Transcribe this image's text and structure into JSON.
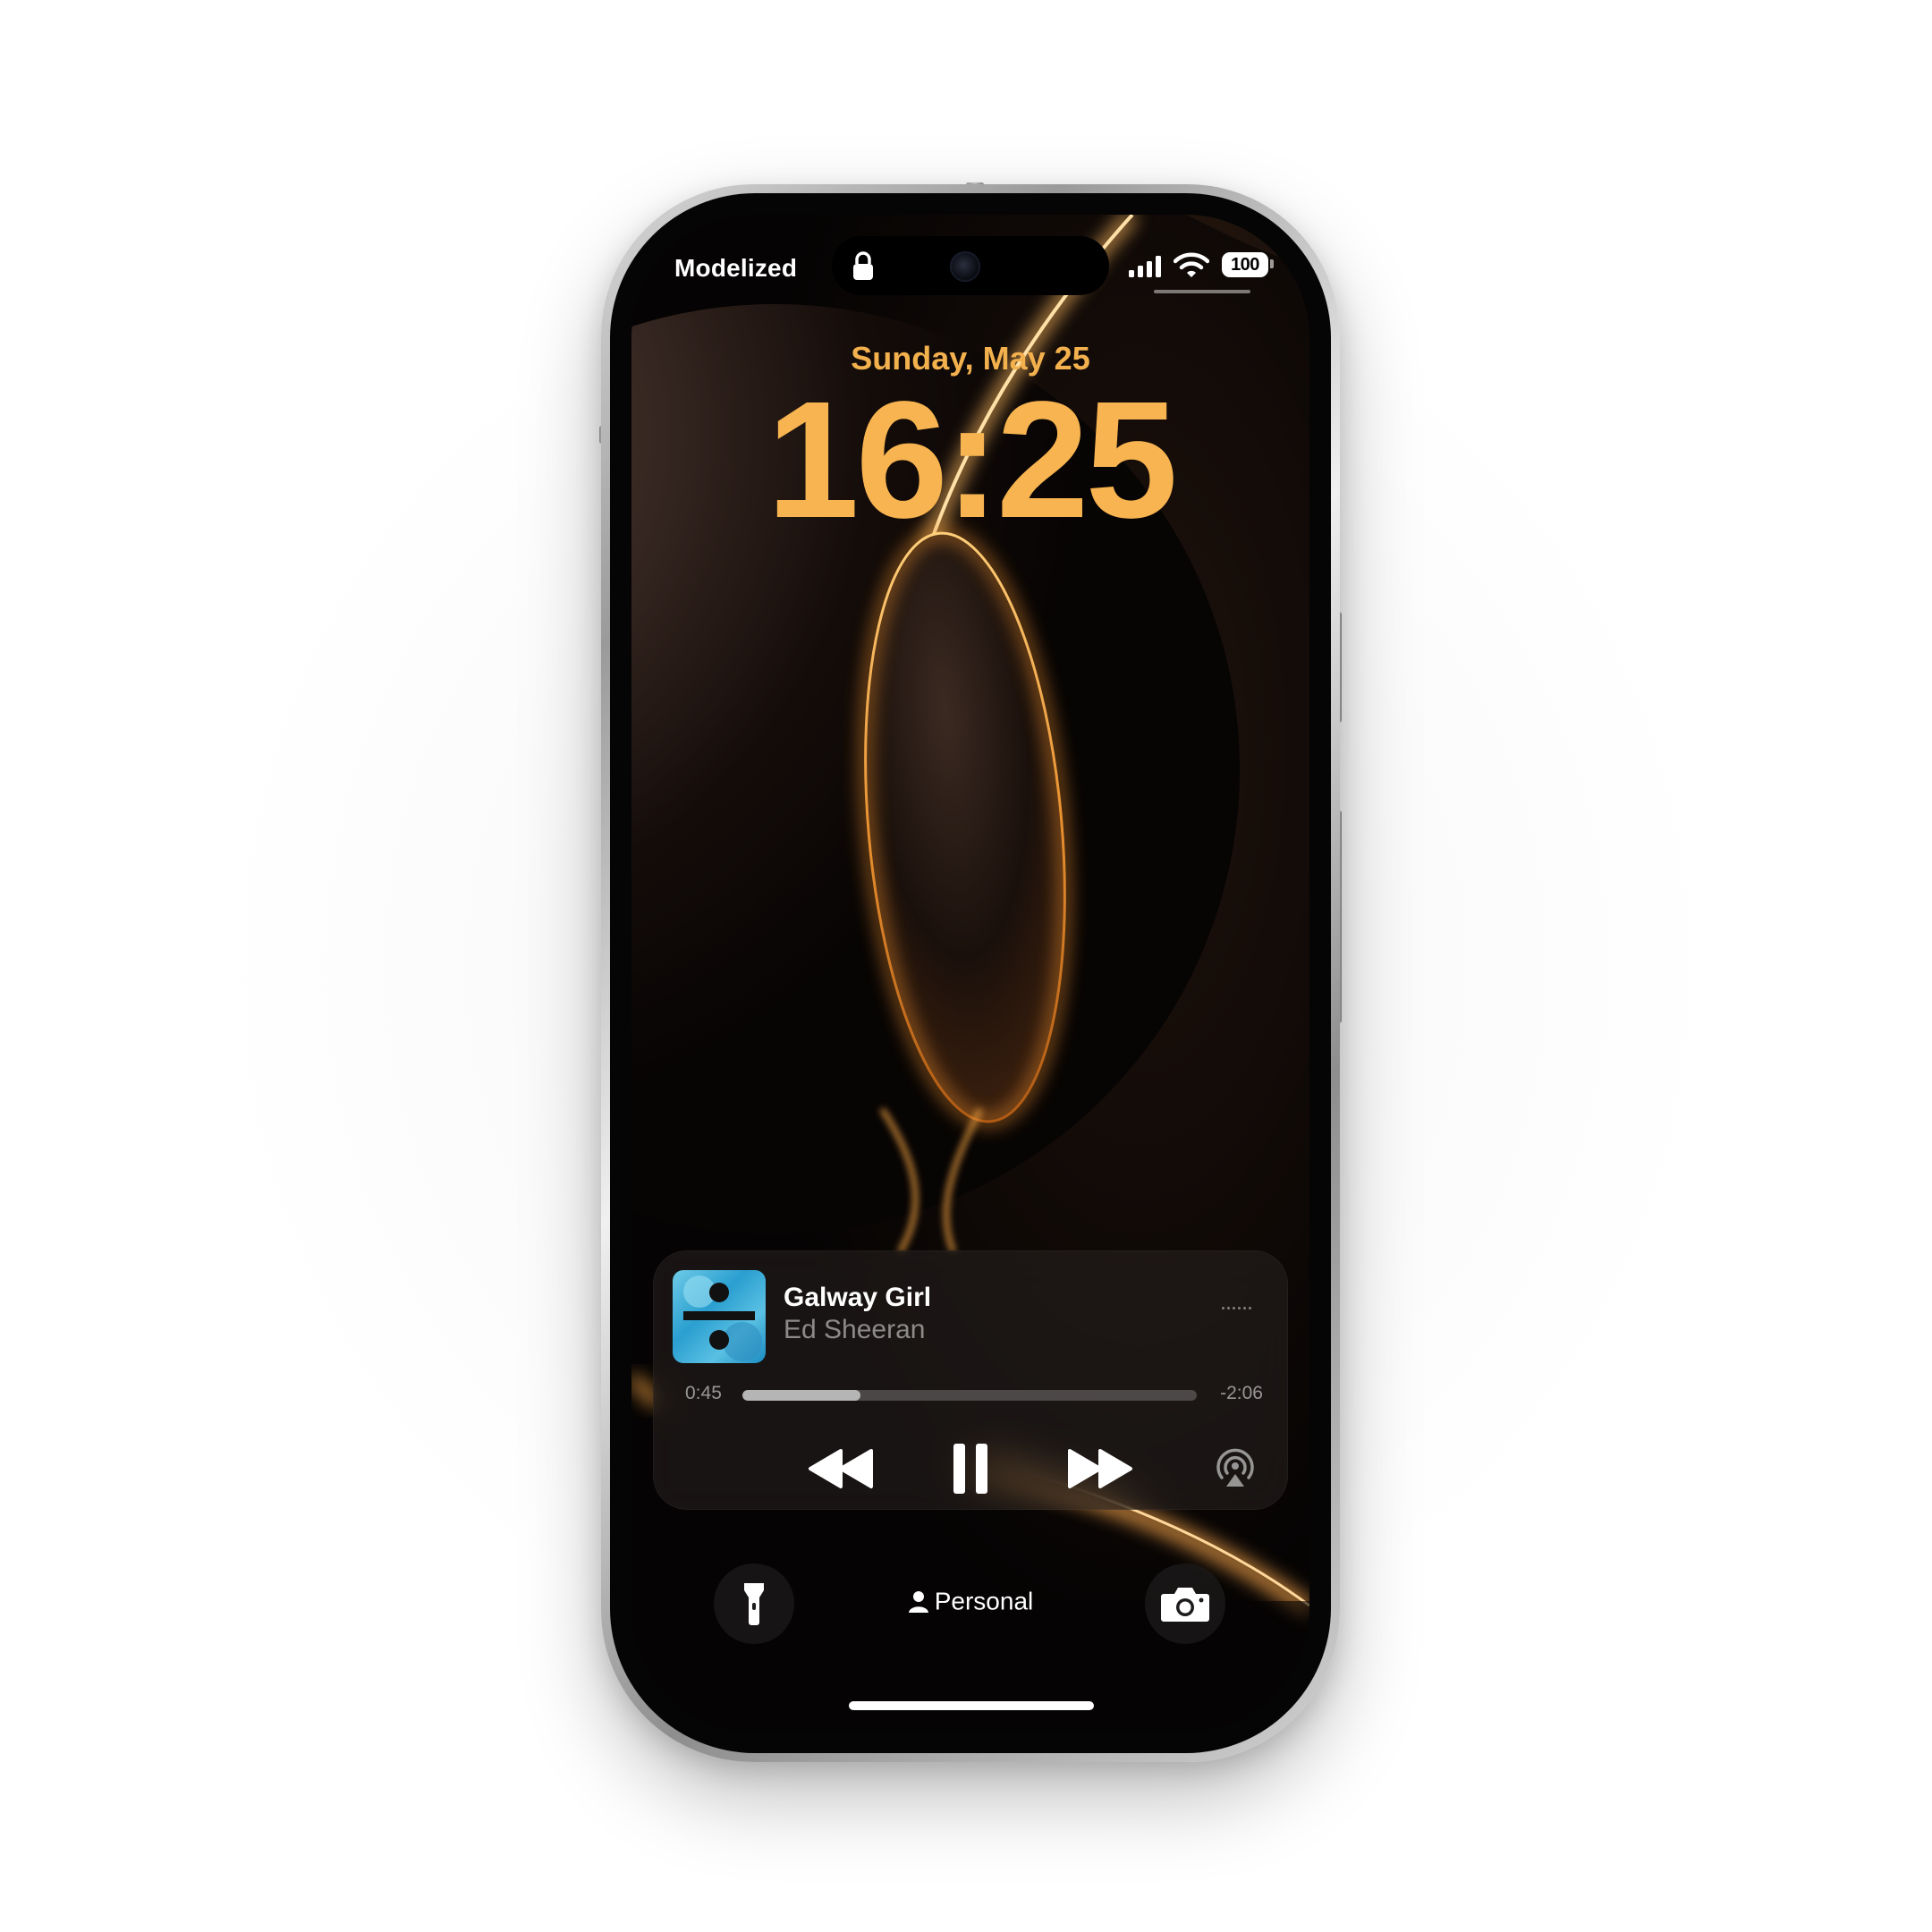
{
  "status_bar": {
    "carrier": "Modelized",
    "battery": "100"
  },
  "lock_screen": {
    "date": "Sunday, May 25",
    "time": "16:25"
  },
  "now_playing": {
    "title": "Galway Girl",
    "artist": "Ed Sheeran",
    "elapsed": "0:45",
    "remaining": "-2:06",
    "progress": 0.26,
    "album_art_icon": "divide-album-art",
    "controls": [
      "rewind-icon",
      "pause-icon",
      "fast-forward-icon",
      "airplay-icon"
    ]
  },
  "bottom_bar": {
    "focus_label": "Personal",
    "left_button_icon": "flashlight-icon",
    "right_button_icon": "camera-icon"
  },
  "colors": {
    "clock": "#f7b450",
    "wallpaper_glow": "#e58a2a",
    "wallpaper_base": "#0c0706"
  }
}
